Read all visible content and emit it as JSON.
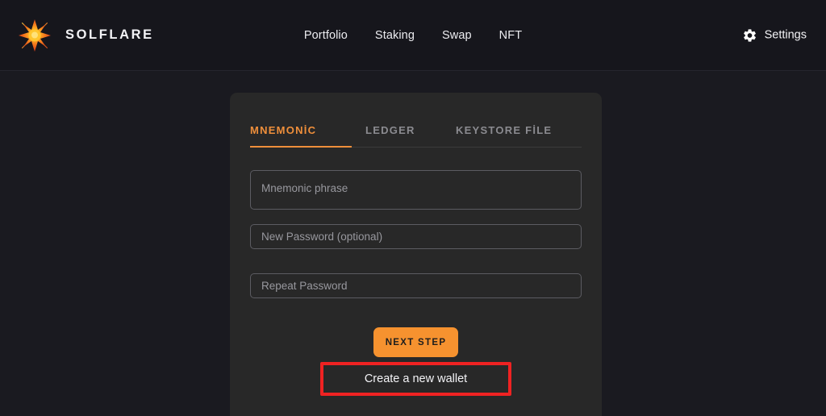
{
  "header": {
    "brand": {
      "name": "SOLFLARE",
      "logo_icon": "solflare-starburst-icon",
      "logo_colors": {
        "core": "#ffd24a",
        "mid": "#f68a1f",
        "edge": "#e0461a"
      }
    },
    "nav": [
      {
        "label": "Portfolio",
        "name": "nav-portfolio"
      },
      {
        "label": "Staking",
        "name": "nav-staking"
      },
      {
        "label": "Swap",
        "name": "nav-swap"
      },
      {
        "label": "NFT",
        "name": "nav-nft"
      }
    ],
    "settings": {
      "label": "Settings",
      "icon": "gear-icon"
    }
  },
  "card": {
    "tabs": [
      {
        "label": "MNEMONİC",
        "active": true
      },
      {
        "label": "LEDGER",
        "active": false
      },
      {
        "label": "KEYSTORE FİLE",
        "active": false
      }
    ],
    "fields": {
      "mnemonic": {
        "placeholder": "Mnemonic phrase",
        "value": ""
      },
      "new_password": {
        "placeholder": "New Password (optional)",
        "value": ""
      },
      "repeat_password": {
        "placeholder": "Repeat Password",
        "value": ""
      }
    },
    "actions": {
      "next_step": "NEXT STEP",
      "create_wallet": "Create a new wallet",
      "highlight_color": "#ef2222"
    }
  },
  "colors": {
    "page_background": "#1a1a20",
    "header_background": "#16161c",
    "card_background": "#282828",
    "accent": "#ef8f3b",
    "button": "#f6922f"
  }
}
